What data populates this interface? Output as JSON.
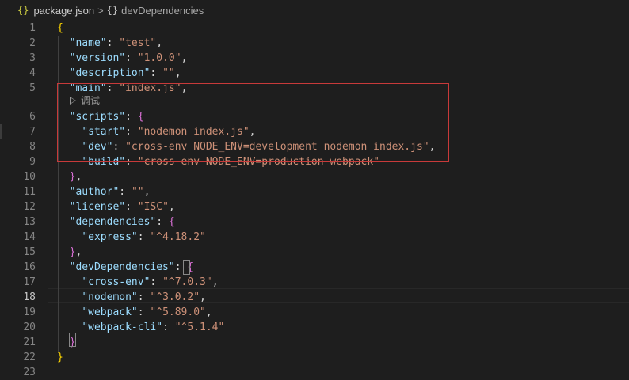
{
  "breadcrumb": {
    "file_icon": "{}",
    "file_name": "package.json",
    "separator": ">",
    "symbol_icon": "{}",
    "symbol_name": "devDependencies"
  },
  "codelens": {
    "icon": "play-icon",
    "label": "调试"
  },
  "active_line": "18",
  "lines": [
    {
      "n": "1",
      "tokens": [
        {
          "t": "b1",
          "v": "{"
        }
      ]
    },
    {
      "n": "2",
      "tokens": [
        {
          "t": "p",
          "v": "  "
        },
        {
          "t": "k",
          "v": "\"name\""
        },
        {
          "t": "p",
          "v": ": "
        },
        {
          "t": "s",
          "v": "\"test\""
        },
        {
          "t": "p",
          "v": ","
        }
      ]
    },
    {
      "n": "3",
      "tokens": [
        {
          "t": "p",
          "v": "  "
        },
        {
          "t": "k",
          "v": "\"version\""
        },
        {
          "t": "p",
          "v": ": "
        },
        {
          "t": "s",
          "v": "\"1.0.0\""
        },
        {
          "t": "p",
          "v": ","
        }
      ]
    },
    {
      "n": "4",
      "tokens": [
        {
          "t": "p",
          "v": "  "
        },
        {
          "t": "k",
          "v": "\"description\""
        },
        {
          "t": "p",
          "v": ": "
        },
        {
          "t": "s",
          "v": "\"\""
        },
        {
          "t": "p",
          "v": ","
        }
      ]
    },
    {
      "n": "5",
      "tokens": [
        {
          "t": "p",
          "v": "  "
        },
        {
          "t": "k",
          "v": "\"main\""
        },
        {
          "t": "p",
          "v": ": "
        },
        {
          "t": "s",
          "v": "\"index.js\""
        },
        {
          "t": "p",
          "v": ","
        }
      ]
    },
    {
      "n": "6",
      "tokens": [
        {
          "t": "p",
          "v": "  "
        },
        {
          "t": "k",
          "v": "\"scripts\""
        },
        {
          "t": "p",
          "v": ": "
        },
        {
          "t": "b2",
          "v": "{"
        }
      ]
    },
    {
      "n": "7",
      "tokens": [
        {
          "t": "p",
          "v": "    "
        },
        {
          "t": "k",
          "v": "\"start\""
        },
        {
          "t": "p",
          "v": ": "
        },
        {
          "t": "s",
          "v": "\"nodemon index.js\""
        },
        {
          "t": "p",
          "v": ","
        }
      ]
    },
    {
      "n": "8",
      "tokens": [
        {
          "t": "p",
          "v": "    "
        },
        {
          "t": "k",
          "v": "\"dev\""
        },
        {
          "t": "p",
          "v": ": "
        },
        {
          "t": "s",
          "v": "\"cross-env NODE_ENV=development nodemon index.js\""
        },
        {
          "t": "p",
          "v": ","
        }
      ]
    },
    {
      "n": "9",
      "tokens": [
        {
          "t": "p",
          "v": "    "
        },
        {
          "t": "k",
          "v": "\"build\""
        },
        {
          "t": "p",
          "v": ": "
        },
        {
          "t": "s",
          "v": "\"cross-env NODE_ENV=production webpack\""
        }
      ]
    },
    {
      "n": "10",
      "tokens": [
        {
          "t": "p",
          "v": "  "
        },
        {
          "t": "b2",
          "v": "}"
        },
        {
          "t": "p",
          "v": ","
        }
      ]
    },
    {
      "n": "11",
      "tokens": [
        {
          "t": "p",
          "v": "  "
        },
        {
          "t": "k",
          "v": "\"author\""
        },
        {
          "t": "p",
          "v": ": "
        },
        {
          "t": "s",
          "v": "\"\""
        },
        {
          "t": "p",
          "v": ","
        }
      ]
    },
    {
      "n": "12",
      "tokens": [
        {
          "t": "p",
          "v": "  "
        },
        {
          "t": "k",
          "v": "\"license\""
        },
        {
          "t": "p",
          "v": ": "
        },
        {
          "t": "s",
          "v": "\"ISC\""
        },
        {
          "t": "p",
          "v": ","
        }
      ]
    },
    {
      "n": "13",
      "tokens": [
        {
          "t": "p",
          "v": "  "
        },
        {
          "t": "k",
          "v": "\"dependencies\""
        },
        {
          "t": "p",
          "v": ": "
        },
        {
          "t": "b2",
          "v": "{"
        }
      ]
    },
    {
      "n": "14",
      "tokens": [
        {
          "t": "p",
          "v": "    "
        },
        {
          "t": "k",
          "v": "\"express\""
        },
        {
          "t": "p",
          "v": ": "
        },
        {
          "t": "s",
          "v": "\"^4.18.2\""
        }
      ]
    },
    {
      "n": "15",
      "tokens": [
        {
          "t": "p",
          "v": "  "
        },
        {
          "t": "b2",
          "v": "}"
        },
        {
          "t": "p",
          "v": ","
        }
      ]
    },
    {
      "n": "16",
      "tokens": [
        {
          "t": "p",
          "v": "  "
        },
        {
          "t": "k",
          "v": "\"devDependencies\""
        },
        {
          "t": "p",
          "v": ": "
        },
        {
          "t": "b2",
          "v": "{"
        }
      ]
    },
    {
      "n": "17",
      "tokens": [
        {
          "t": "p",
          "v": "    "
        },
        {
          "t": "k",
          "v": "\"cross-env\""
        },
        {
          "t": "p",
          "v": ": "
        },
        {
          "t": "s",
          "v": "\"^7.0.3\""
        },
        {
          "t": "p",
          "v": ","
        }
      ]
    },
    {
      "n": "18",
      "tokens": [
        {
          "t": "p",
          "v": "    "
        },
        {
          "t": "k",
          "v": "\"nodemon\""
        },
        {
          "t": "p",
          "v": ": "
        },
        {
          "t": "s",
          "v": "\"^3.0.2\""
        },
        {
          "t": "p",
          "v": ","
        }
      ]
    },
    {
      "n": "19",
      "tokens": [
        {
          "t": "p",
          "v": "    "
        },
        {
          "t": "k",
          "v": "\"webpack\""
        },
        {
          "t": "p",
          "v": ": "
        },
        {
          "t": "s",
          "v": "\"^5.89.0\""
        },
        {
          "t": "p",
          "v": ","
        }
      ]
    },
    {
      "n": "20",
      "tokens": [
        {
          "t": "p",
          "v": "    "
        },
        {
          "t": "k",
          "v": "\"webpack-cli\""
        },
        {
          "t": "p",
          "v": ": "
        },
        {
          "t": "s",
          "v": "\"^5.1.4\""
        }
      ]
    },
    {
      "n": "21",
      "tokens": [
        {
          "t": "p",
          "v": "  "
        },
        {
          "t": "b2",
          "v": "}"
        }
      ]
    },
    {
      "n": "22",
      "tokens": [
        {
          "t": "b1",
          "v": "}"
        }
      ]
    },
    {
      "n": "23",
      "tokens": []
    }
  ],
  "colors": {
    "background": "#1e1e1e",
    "key": "#9cdcfe",
    "string": "#ce9178",
    "bracket_outer": "#ffd700",
    "bracket_inner": "#da70d6",
    "highlight_box": "#c83a3a"
  }
}
